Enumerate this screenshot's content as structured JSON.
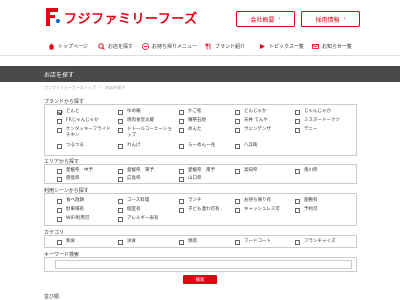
{
  "header": {
    "logo_text": "フジファミリーフーズ",
    "company_button": "会社概要",
    "recruit_button": "採用情報",
    "brand_color": "#e60012"
  },
  "nav": {
    "items": [
      {
        "label": "トップページ",
        "icon": "home-icon"
      },
      {
        "label": "お店を探す",
        "icon": "search-icon"
      },
      {
        "label": "お持ち帰りメニュー",
        "icon": "takeout-icon"
      },
      {
        "label": "ブランド紹介",
        "icon": "fork-icon"
      },
      {
        "label": "トピックス一覧",
        "icon": "topics-icon"
      },
      {
        "label": "お知らせ一覧",
        "icon": "mail-icon"
      }
    ]
  },
  "page_title": "お店を探す",
  "breadcrumb": "フジファミリーフーズトップ　›　お店を探す",
  "brand": {
    "label": "ブランドから探す",
    "options": [
      {
        "label": "どんと",
        "checked": true
      },
      {
        "label": "ゆめ庵",
        "checked": false
      },
      {
        "label": "かご松",
        "checked": false
      },
      {
        "label": "どんじゃか",
        "checked": false
      },
      {
        "label": "じゃんじゃか",
        "checked": false
      },
      {
        "label": "FRじゃんじゃか",
        "checked": false
      },
      {
        "label": "焼肉食堂炎蔵",
        "checked": false
      },
      {
        "label": "曜祭石焼",
        "checked": false
      },
      {
        "label": "天丼 てんや",
        "checked": false
      },
      {
        "label": "ミスタードーナツ",
        "checked": false
      },
      {
        "label": "ケンタッキーフライドチキン",
        "checked": false
      },
      {
        "label": "ドトールコーヒーショップ",
        "checked": false
      },
      {
        "label": "めんた",
        "checked": false
      },
      {
        "label": "ヴェンデンザ",
        "checked": false
      },
      {
        "label": "デニー",
        "checked": false
      },
      {
        "label": "つるつる",
        "checked": false
      },
      {
        "label": "れんげ",
        "checked": false
      },
      {
        "label": "らーめん一兆",
        "checked": false
      },
      {
        "label": "八兵衛",
        "checked": false
      }
    ]
  },
  "area": {
    "label": "エリアから探す",
    "options": [
      {
        "label": "愛媛県　中予",
        "checked": false
      },
      {
        "label": "愛媛県　東予",
        "checked": false
      },
      {
        "label": "愛媛県　南予",
        "checked": false
      },
      {
        "label": "高知県",
        "checked": false
      },
      {
        "label": "香川県",
        "checked": false
      },
      {
        "label": "徳島県",
        "checked": false
      },
      {
        "label": "広島県",
        "checked": false
      },
      {
        "label": "山口県",
        "checked": false
      }
    ]
  },
  "scene": {
    "label": "利用シーンから探す",
    "options": [
      {
        "label": "食べ放題",
        "checked": false
      },
      {
        "label": "コース料理",
        "checked": false
      },
      {
        "label": "ランチ",
        "checked": false
      },
      {
        "label": "お持ち帰り有",
        "checked": false
      },
      {
        "label": "座敷有",
        "checked": false
      },
      {
        "label": "駐車場有",
        "checked": false
      },
      {
        "label": "個室有",
        "checked": false
      },
      {
        "label": "子ども連れ可有",
        "checked": false
      },
      {
        "label": "キャッシュレス可",
        "checked": false
      },
      {
        "label": "予約可",
        "checked": false
      },
      {
        "label": "WIFI利用可",
        "checked": false
      },
      {
        "label": "アレルギー表有",
        "checked": false
      }
    ]
  },
  "category": {
    "label": "カテゴリ",
    "options": [
      {
        "label": "和食",
        "checked": false
      },
      {
        "label": "洋食",
        "checked": false
      },
      {
        "label": "焼肉",
        "checked": false
      },
      {
        "label": "フードコート",
        "checked": false
      },
      {
        "label": "フランチャイズ",
        "checked": false
      }
    ]
  },
  "keyword": {
    "label": "キーワード検索",
    "placeholder": ""
  },
  "search_button": "検索",
  "sort_label": "並び順"
}
